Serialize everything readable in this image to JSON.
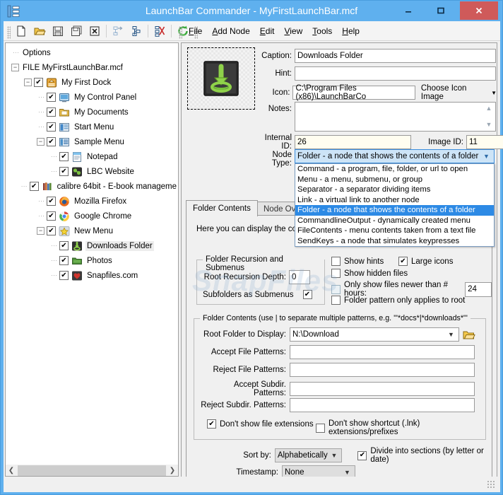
{
  "window": {
    "title": "LaunchBar Commander - MyFirstLaunchBar.mcf",
    "minimize": "–",
    "maximize": "❐",
    "close": "✕"
  },
  "toolbar": {
    "buttons": [
      {
        "name": "new-file",
        "glyph": "new"
      },
      {
        "name": "open-file",
        "glyph": "open"
      },
      {
        "name": "save-file",
        "glyph": "save"
      },
      {
        "name": "save-as",
        "glyph": "saveas"
      },
      {
        "name": "close-file",
        "glyph": "closex"
      },
      {
        "name": "add-child-node",
        "glyph": "addchild"
      },
      {
        "name": "add-sibling-node",
        "glyph": "addsibling"
      },
      {
        "name": "delete-node",
        "glyph": "cut"
      },
      {
        "name": "refresh",
        "glyph": "refresh"
      }
    ]
  },
  "menubar": {
    "items": [
      {
        "label": "File",
        "accel": "F"
      },
      {
        "label": "Add Node",
        "accel": "A"
      },
      {
        "label": "Edit",
        "accel": "E"
      },
      {
        "label": "View",
        "accel": "V"
      },
      {
        "label": "Tools",
        "accel": "T"
      },
      {
        "label": "Help",
        "accel": "H"
      }
    ]
  },
  "tree": {
    "items": [
      {
        "label": "Options",
        "depth": 0,
        "expander": "none",
        "checkbox": false,
        "icon": "none",
        "selected": false
      },
      {
        "label": "FILE MyFirstLaunchBar.mcf",
        "depth": 0,
        "expander": "minus",
        "checkbox": false,
        "icon": "none",
        "selected": false
      },
      {
        "label": "My First Dock",
        "depth": 1,
        "expander": "minus",
        "checkbox": true,
        "icon": "dock",
        "selected": false
      },
      {
        "label": "My Control Panel",
        "depth": 2,
        "expander": "none",
        "checkbox": true,
        "icon": "cpanel",
        "selected": false
      },
      {
        "label": "My Documents",
        "depth": 2,
        "expander": "none",
        "checkbox": true,
        "icon": "docs",
        "selected": false
      },
      {
        "label": "Start Menu",
        "depth": 2,
        "expander": "none",
        "checkbox": true,
        "icon": "start",
        "selected": false
      },
      {
        "label": "Sample Menu",
        "depth": 2,
        "expander": "minus",
        "checkbox": true,
        "icon": "menu",
        "selected": false
      },
      {
        "label": "Notepad",
        "depth": 3,
        "expander": "none",
        "checkbox": true,
        "icon": "notepad",
        "selected": false
      },
      {
        "label": "LBC Website",
        "depth": 3,
        "expander": "none",
        "checkbox": true,
        "icon": "web",
        "selected": false
      },
      {
        "label": "calibre 64bit - E-book manageme",
        "depth": 2,
        "expander": "none",
        "checkbox": true,
        "icon": "calibre",
        "selected": false
      },
      {
        "label": "Mozilla Firefox",
        "depth": 2,
        "expander": "none",
        "checkbox": true,
        "icon": "firefox",
        "selected": false
      },
      {
        "label": "Google Chrome",
        "depth": 2,
        "expander": "none",
        "checkbox": true,
        "icon": "chrome",
        "selected": false
      },
      {
        "label": "New Menu",
        "depth": 2,
        "expander": "minus",
        "checkbox": true,
        "icon": "star",
        "selected": false
      },
      {
        "label": "Downloads Folder",
        "depth": 3,
        "expander": "none",
        "checkbox": true,
        "icon": "download",
        "selected": true
      },
      {
        "label": "Photos",
        "depth": 3,
        "expander": "none",
        "checkbox": true,
        "icon": "folder",
        "selected": false
      },
      {
        "label": "Snapfiles.com",
        "depth": 3,
        "expander": "none",
        "checkbox": true,
        "icon": "heart",
        "selected": false
      }
    ],
    "scroll_left_arrow": "❮",
    "scroll_right_arrow": "❯"
  },
  "form": {
    "caption_label": "Caption:",
    "caption_value": "Downloads Folder",
    "hint_label": "Hint:",
    "hint_value": "",
    "icon_label": "Icon:",
    "icon_value": "C:\\Program Files (x86)\\LaunchBarCo",
    "choose_icon_label": "Choose Icon Image",
    "notes_label": "Notes:",
    "notes_value": "",
    "internal_id_label": "Internal ID:",
    "internal_id_value": "26",
    "image_id_label": "Image ID:",
    "image_id_value": "11",
    "node_type_label": "Node Type:",
    "node_type_value": "Folder - a node that shows the contents of a folder"
  },
  "node_type_dropdown": {
    "options": [
      {
        "label": "Command - a program, file, folder, or url to open",
        "selected": false
      },
      {
        "label": "Menu - a menu, submenu, or group",
        "selected": false
      },
      {
        "label": "Separator - a separator dividing items",
        "selected": false
      },
      {
        "label": "Link - a virtual link to another node",
        "selected": false
      },
      {
        "label": "Folder - a node that shows the contents of a folder",
        "selected": true
      },
      {
        "label": "CommandlineOutput - dynamically created menu",
        "selected": false
      },
      {
        "label": "FileContents - menu contents taken from a text file",
        "selected": false
      },
      {
        "label": "SendKeys - a node that simulates keypresses",
        "selected": false
      }
    ]
  },
  "tabs": [
    {
      "label": "Folder Contents",
      "active": true
    },
    {
      "label": "Node Overrides",
      "active": false
    }
  ],
  "folder_contents": {
    "help_text": "Here you can display the contents of folders.",
    "recursion_group": {
      "title": "Folder Recursion and Submenus",
      "depth_label": "Root Recursion Depth:",
      "depth_value": "0",
      "subfolders_label": "Subfolders as Submenus",
      "subfolders_checked": true
    },
    "options": [
      {
        "label": "Show hints",
        "checked": false,
        "dim": false
      },
      {
        "label": "Large icons",
        "checked": true,
        "dim": false
      },
      {
        "label": "Show hidden files",
        "checked": false,
        "dim": false
      },
      {
        "label": "Only show files newer than # hours:",
        "checked": false,
        "dim": true
      },
      {
        "label": "Folder pattern only applies to root",
        "checked": false,
        "dim": false
      }
    ],
    "hours_value": "24",
    "patterns_group": {
      "title": "Folder Contents (use | to separate multiple patterns, e.g. '\"*docs*|*downloads*\"'",
      "root_folder_label": "Root Folder to Display:",
      "root_folder_value": "N:\\Download",
      "accept_file_label": "Accept File Patterns:",
      "accept_file_value": "",
      "reject_file_label": "Reject File Patterns:",
      "reject_file_value": "",
      "accept_subdir_label": "Accept Subdir. Patterns:",
      "accept_subdir_value": "",
      "reject_subdir_label": "Reject Subdir. Patterns:",
      "reject_subdir_value": "",
      "no_ext_label": "Don't show file extensions",
      "no_ext_checked": true,
      "no_lnk_label": "Don't show shortcut (.lnk) extensions/prefixes",
      "no_lnk_checked": false
    },
    "sort_label": "Sort by:",
    "sort_value": "Alphabetically",
    "divide_label": "Divide into sections (by letter or date)",
    "divide_checked": true,
    "timestamp_label": "Timestamp:",
    "timestamp_value": "None"
  },
  "watermark": "SnapFiles",
  "colors": {
    "frame": "#5fb0ee",
    "close_button": "#cf5a5a",
    "selection": "#2d8ae5",
    "combo_focus": "#cde4f7"
  }
}
